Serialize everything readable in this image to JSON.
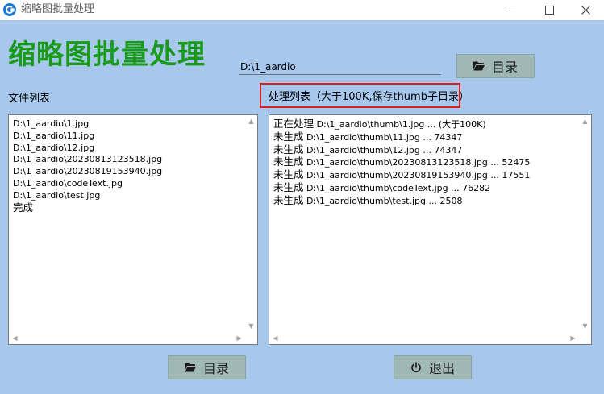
{
  "window": {
    "title": "缩略图批量处理",
    "minimize_icon": "minimize-icon",
    "maximize_icon": "maximize-icon",
    "close_icon": "close-icon"
  },
  "header": {
    "big_title": "缩略图批量处理",
    "path_value": "D:\\1_aardio",
    "dir_button_label": "目录",
    "dir_button_icon": "folder-icon"
  },
  "files_panel": {
    "label": "文件列表",
    "items": [
      "D:\\1_aardio\\1.jpg",
      "D:\\1_aardio\\11.jpg",
      "D:\\1_aardio\\12.jpg",
      "D:\\1_aardio\\20230813123518.jpg",
      "D:\\1_aardio\\20230819153940.jpg",
      "D:\\1_aardio\\codeText.jpg",
      "D:\\1_aardio\\test.jpg",
      "完成"
    ]
  },
  "process_panel": {
    "label": "处理列表（大于100K,保存thumb子目录）",
    "label_highlight_color": "#e21b1b",
    "items": [
      {
        "status": "正在处理",
        "path": " D:\\1_aardio\\thumb\\1.jpg ... (大于100K)"
      },
      {
        "status": "未生成",
        "path": " D:\\1_aardio\\thumb\\11.jpg ... 74347"
      },
      {
        "status": "未生成",
        "path": " D:\\1_aardio\\thumb\\12.jpg ... 74347"
      },
      {
        "status": "未生成",
        "path": " D:\\1_aardio\\thumb\\20230813123518.jpg ... 52475"
      },
      {
        "status": "未生成",
        "path": " D:\\1_aardio\\thumb\\20230819153940.jpg ... 17551"
      },
      {
        "status": "未生成",
        "path": " D:\\1_aardio\\thumb\\codeText.jpg ... 76282"
      },
      {
        "status": "未生成",
        "path": " D:\\1_aardio\\thumb\\test.jpg ... 2508"
      }
    ]
  },
  "footer": {
    "dir_button_label": "目录",
    "dir_button_icon": "folder-icon",
    "exit_button_label": "退出",
    "exit_button_icon": "power-icon"
  },
  "colors": {
    "background": "#a7c8ec",
    "title_green": "#1a9a1a",
    "button_bg": "#9fb8b5"
  }
}
